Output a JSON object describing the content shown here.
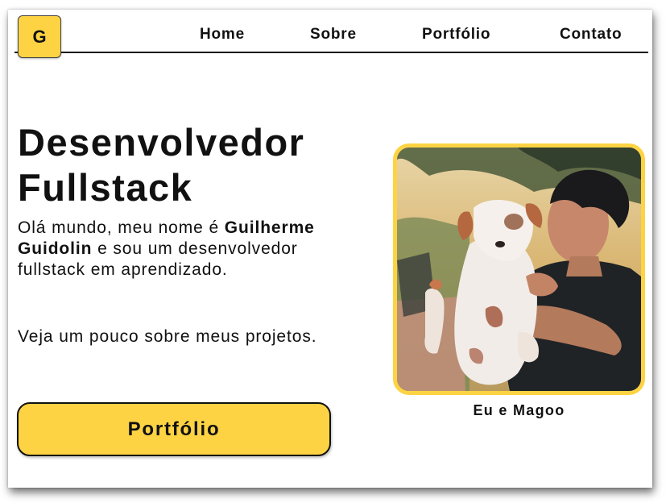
{
  "header": {
    "logo_letter": "G",
    "nav": [
      "Home",
      "Sobre",
      "Portfólio",
      "Contato"
    ]
  },
  "hero": {
    "title_line1": "Desenvolvedor",
    "title_line2": "Fullstack",
    "intro_before": "Olá mundo, meu nome é ",
    "intro_name": "Guilherme Guidolin",
    "intro_after": " e sou um desenvolvedor fullstack em aprendizado.",
    "intro2": "Veja um pouco sobre meus projetos.",
    "cta_label": "Portfólio"
  },
  "photo": {
    "caption": "Eu e Magoo"
  },
  "colors": {
    "accent": "#fdd343",
    "text": "#111111"
  }
}
